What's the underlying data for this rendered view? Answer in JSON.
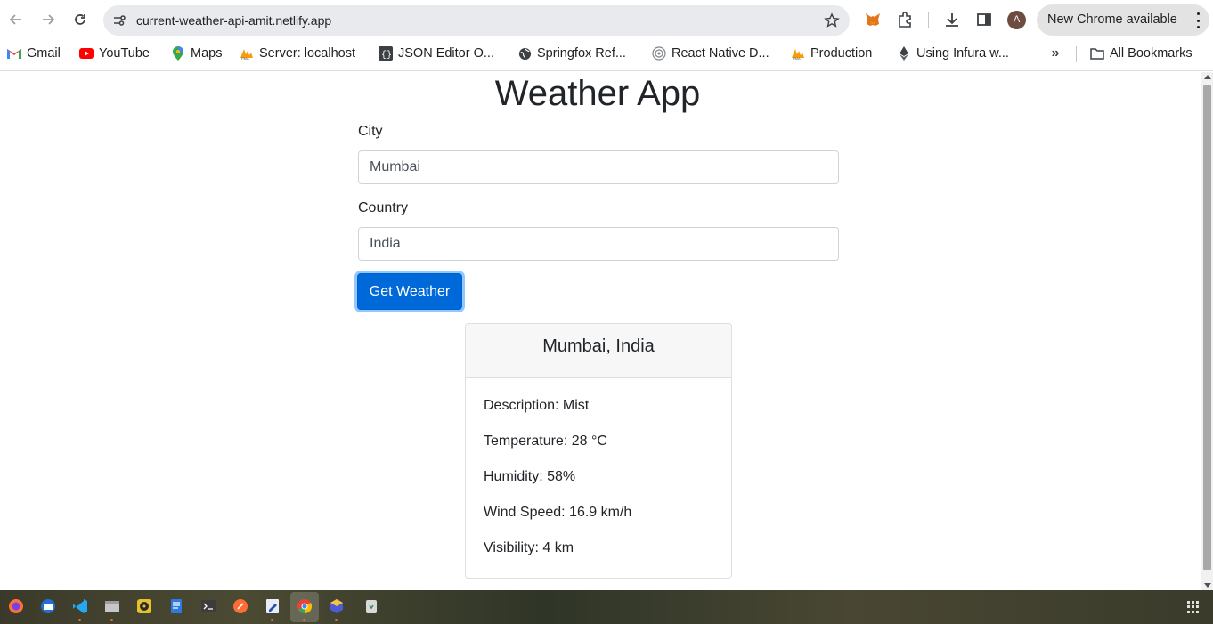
{
  "browser": {
    "url": "current-weather-api-amit.netlify.app",
    "avatar_letter": "A",
    "update_label": "New Chrome available",
    "icons": [
      "back-icon",
      "forward-icon",
      "reload-icon",
      "site-info-icon",
      "star-icon",
      "metamask-icon",
      "extensions-icon",
      "download-icon",
      "side-panel-icon",
      "more-icon"
    ]
  },
  "bookmarks": {
    "items": [
      {
        "label": "Gmail",
        "icon": "gmail-icon"
      },
      {
        "label": "YouTube",
        "icon": "youtube-icon"
      },
      {
        "label": "Maps",
        "icon": "maps-icon"
      },
      {
        "label": "Server: localhost",
        "icon": "phpmyadmin-icon"
      },
      {
        "label": "JSON Editor O...",
        "icon": "json-editor-icon"
      },
      {
        "label": "Springfox Ref...",
        "icon": "globe-icon"
      },
      {
        "label": "React Native D...",
        "icon": "react-icon"
      },
      {
        "label": "Production",
        "icon": "phpmyadmin-icon"
      },
      {
        "label": "Using Infura w...",
        "icon": "ethereum-icon"
      }
    ],
    "more": "»",
    "all_bookmarks": "All Bookmarks"
  },
  "page": {
    "title": "Weather App",
    "city_label": "City",
    "city_value": "Mumbai",
    "country_label": "Country",
    "country_value": "India",
    "submit_label": "Get Weather",
    "card": {
      "header": "Mumbai, India",
      "description": "Description: Mist",
      "temperature": "Temperature: 28 °C",
      "humidity": "Humidity: 58%",
      "wind_speed": "Wind Speed: 16.9 km/h",
      "visibility": "Visibility: 4 km"
    }
  },
  "taskbar": {
    "apps": [
      "firefox-icon",
      "thunderbird-icon",
      "vscode-icon",
      "files-icon",
      "rhythmbox-icon",
      "text-editor-icon",
      "terminal-icon",
      "postman-icon",
      "notes-icon",
      "chrome-icon",
      "cube-app-icon",
      "trash-icon"
    ],
    "accent": "#e66a3c"
  },
  "colors": {
    "primary": "#0069d9",
    "chrome_toolbar": "#ffffff",
    "omnibox": "#e8eaed"
  }
}
